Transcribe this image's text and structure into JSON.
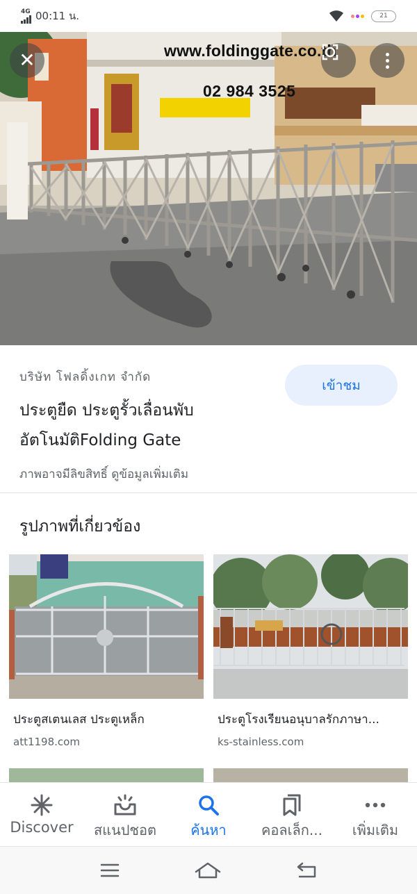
{
  "status_bar": {
    "network": "4G",
    "time": "00:11 น.",
    "battery": "21"
  },
  "hero": {
    "url_text": "www.foldinggate.co.th",
    "phone_text": "02 984 3525",
    "close_icon": "close-icon",
    "lens_icon": "lens-icon",
    "more_icon": "more-vert-icon"
  },
  "info": {
    "source_name": "บริษัท โฟลดิ้งเกท จำกัด",
    "visit_label": "เข้าชม",
    "title": "ประตูยืด ประตูรั้วเลื่อนพับอัตโนมัติFolding Gate",
    "copyright_notice": "ภาพอาจมีลิขสิทธิ์ ดูข้อมูลเพิ่มเติม"
  },
  "related": {
    "heading": "รูปภาพที่เกี่ยวข้อง",
    "items": [
      {
        "title": "ประตูสเตนเลส ประตูเหล็ก",
        "source": "att1198.com"
      },
      {
        "title": "ประตูโรงเรียนอนุบาลรักภาษา...",
        "source": "ks-stainless.com"
      }
    ]
  },
  "bottom_nav": {
    "items": [
      {
        "label": "Discover",
        "icon": "asterisk-icon"
      },
      {
        "label": "สแนปชอต",
        "icon": "snapshot-icon"
      },
      {
        "label": "ค้นหา",
        "icon": "search-icon"
      },
      {
        "label": "คอลเล็ก...",
        "icon": "collections-icon"
      },
      {
        "label": "เพิ่มเติม",
        "icon": "more-horiz-icon"
      }
    ],
    "active_color": "#1a73e8"
  },
  "system_nav": {
    "icons": [
      "recents-icon",
      "home-icon",
      "back-icon"
    ]
  }
}
